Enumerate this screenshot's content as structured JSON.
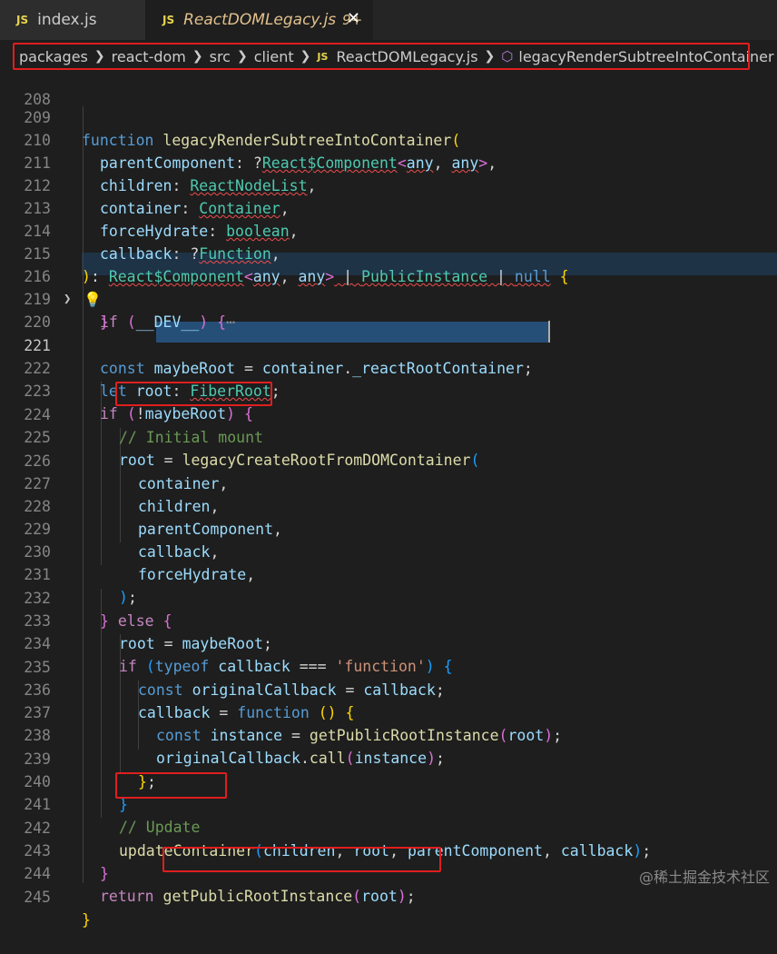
{
  "tabs": [
    {
      "icon": "JS",
      "label": "index.js"
    },
    {
      "icon": "JS",
      "label": "ReactDOMLegacy.js",
      "badge": "9+",
      "close": "✕"
    }
  ],
  "breadcrumb": {
    "items": [
      "packages",
      "react-dom",
      "src",
      "client"
    ],
    "file": "ReactDOMLegacy.js",
    "file_icon": "JS",
    "symbol": "legacyRenderSubtreeIntoContainer"
  },
  "folded_hint": "⋯",
  "watermark": "@稀土掘金技术社区",
  "lines": [
    {
      "n": "208",
      "t": ""
    },
    {
      "n": "209",
      "t": "function legacyRenderSubtreeIntoContainer("
    },
    {
      "n": "210",
      "t": "parentComponent: ?React$Component<any, any>,"
    },
    {
      "n": "211",
      "t": "children: ReactNodeList,"
    },
    {
      "n": "212",
      "t": "container: Container,"
    },
    {
      "n": "213",
      "t": "forceHydrate: boolean,"
    },
    {
      "n": "214",
      "t": "callback: ?Function,"
    },
    {
      "n": "215",
      "t": "): React$Component<any, any> | PublicInstance | null {"
    },
    {
      "n": "216",
      "t": "if (__DEV__) {"
    },
    {
      "n": "219",
      "t": "}"
    },
    {
      "n": "220",
      "t": ""
    },
    {
      "n": "221",
      "t": "const maybeRoot = container._reactRootContainer;"
    },
    {
      "n": "222",
      "t": "let root: FiberRoot;"
    },
    {
      "n": "223",
      "t": "if (!maybeRoot) {"
    },
    {
      "n": "224",
      "t": "// Initial mount"
    },
    {
      "n": "225",
      "t": "root = legacyCreateRootFromDOMContainer("
    },
    {
      "n": "226",
      "t": "container,"
    },
    {
      "n": "227",
      "t": "children,"
    },
    {
      "n": "228",
      "t": "parentComponent,"
    },
    {
      "n": "229",
      "t": "callback,"
    },
    {
      "n": "230",
      "t": "forceHydrate,"
    },
    {
      "n": "231",
      "t": ");"
    },
    {
      "n": "232",
      "t": "} else {"
    },
    {
      "n": "233",
      "t": "root = maybeRoot;"
    },
    {
      "n": "234",
      "t": "if (typeof callback === 'function') {"
    },
    {
      "n": "235",
      "t": "const originalCallback = callback;"
    },
    {
      "n": "236",
      "t": "callback = function () {"
    },
    {
      "n": "237",
      "t": "const instance = getPublicRootInstance(root);"
    },
    {
      "n": "238",
      "t": "originalCallback.call(instance);"
    },
    {
      "n": "239",
      "t": "};"
    },
    {
      "n": "240",
      "t": "}"
    },
    {
      "n": "241",
      "t": "// Update"
    },
    {
      "n": "242",
      "t": "updateContainer(children, root, parentComponent, callback);"
    },
    {
      "n": "243",
      "t": "}"
    },
    {
      "n": "244",
      "t": "return getPublicRootInstance(root);"
    },
    {
      "n": "245",
      "t": "}"
    }
  ],
  "colors": {
    "background": "#1e1e1e",
    "keyword": "#569cd6",
    "control": "#c586c0",
    "function": "#dcdcaa",
    "variable": "#9cdcfe",
    "type": "#4ec9b0",
    "string": "#ce9178",
    "comment": "#6a9955",
    "annotation_box": "#e01e1e"
  }
}
